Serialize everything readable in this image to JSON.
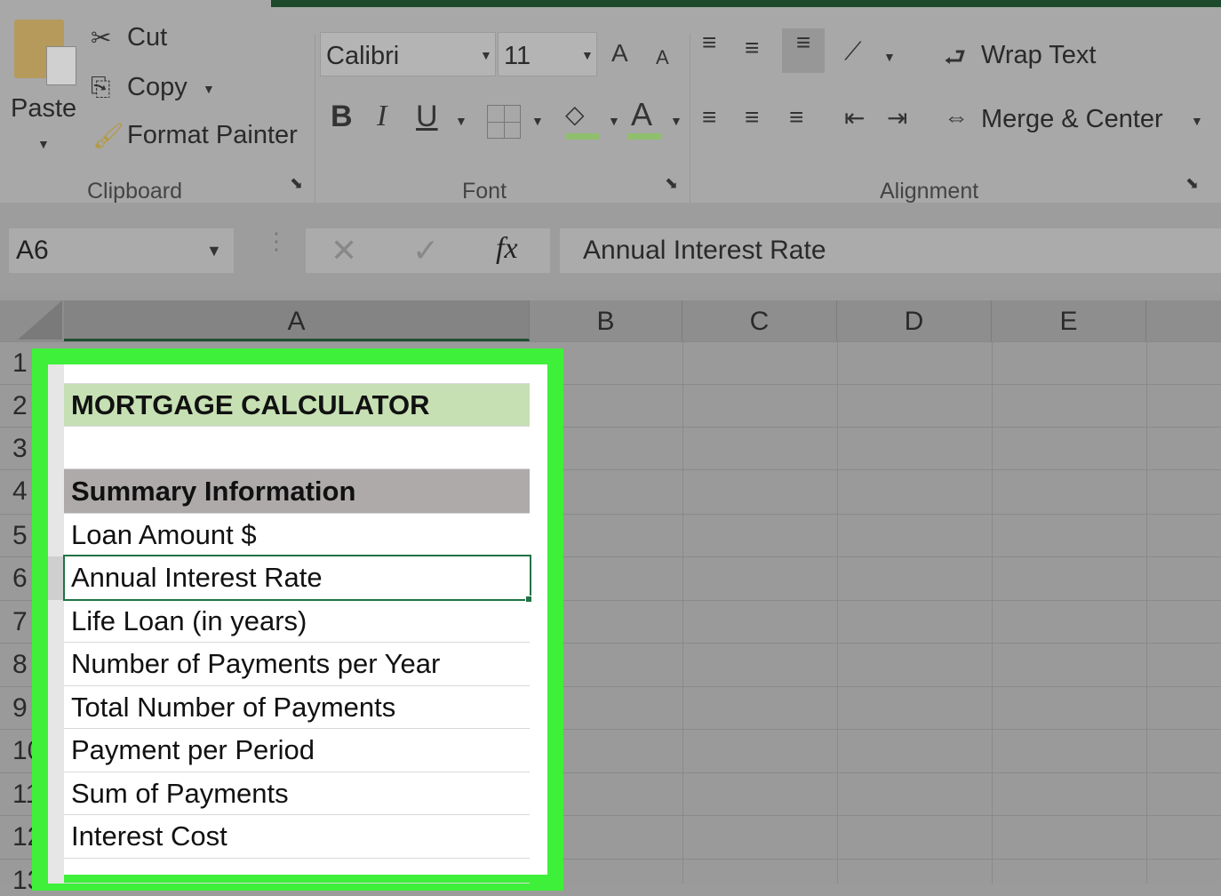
{
  "ribbon": {
    "clipboard": {
      "paste": "Paste",
      "cut": "Cut",
      "copy": "Copy",
      "format_painter": "Format Painter",
      "group_label": "Clipboard"
    },
    "font": {
      "font_name": "Calibri",
      "font_size": "11",
      "group_label": "Font",
      "bold": "B",
      "italic": "I",
      "underline": "U"
    },
    "alignment": {
      "wrap_text": "Wrap Text",
      "merge_center": "Merge & Center",
      "group_label": "Alignment"
    }
  },
  "formula_bar": {
    "name_box": "A6",
    "fx": "fx",
    "value": "Annual Interest Rate"
  },
  "columns": [
    "A",
    "B",
    "C",
    "D",
    "E"
  ],
  "rows": [
    "1",
    "2",
    "3",
    "4",
    "5",
    "6",
    "7",
    "8",
    "9",
    "10",
    "11",
    "12",
    "13"
  ],
  "cells": [
    "",
    "MORTGAGE CALCULATOR",
    "",
    "Summary Information",
    "Loan Amount $",
    "Annual Interest Rate",
    "Life Loan (in years)",
    "Number of Payments per Year",
    "Total Number of Payments",
    "Payment per Period",
    "Sum of Payments",
    "Interest Cost",
    ""
  ],
  "colors": {
    "highlight": "#3ff03a",
    "title_fill": "#c6e0b4",
    "section_fill": "#aeaaaa",
    "selection": "#217346"
  }
}
